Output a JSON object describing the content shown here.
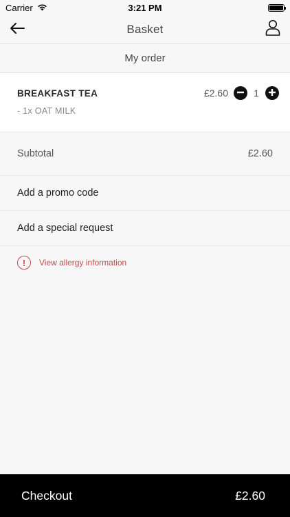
{
  "status_bar": {
    "carrier": "Carrier",
    "time": "3:21 PM"
  },
  "nav": {
    "title": "Basket"
  },
  "section": {
    "title": "My order"
  },
  "order_items": [
    {
      "name": "BREAKFAST TEA",
      "modifier": "- 1x OAT MILK",
      "price": "£2.60",
      "quantity": "1"
    }
  ],
  "subtotal": {
    "label": "Subtotal",
    "value": "£2.60"
  },
  "promo": {
    "label": "Add a promo code"
  },
  "special_request": {
    "label": "Add a special request"
  },
  "allergy": {
    "icon_glyph": "!",
    "label": "View allergy information",
    "color": "#c44a4a"
  },
  "checkout": {
    "label": "Checkout",
    "total": "£2.60"
  },
  "icons": {
    "back": "arrow-left-icon",
    "account": "user-icon",
    "decrement": "minus-circle-icon",
    "increment": "plus-circle-icon",
    "wifi": "wifi-icon",
    "battery": "battery-icon",
    "allergy": "alert-circle-icon"
  }
}
